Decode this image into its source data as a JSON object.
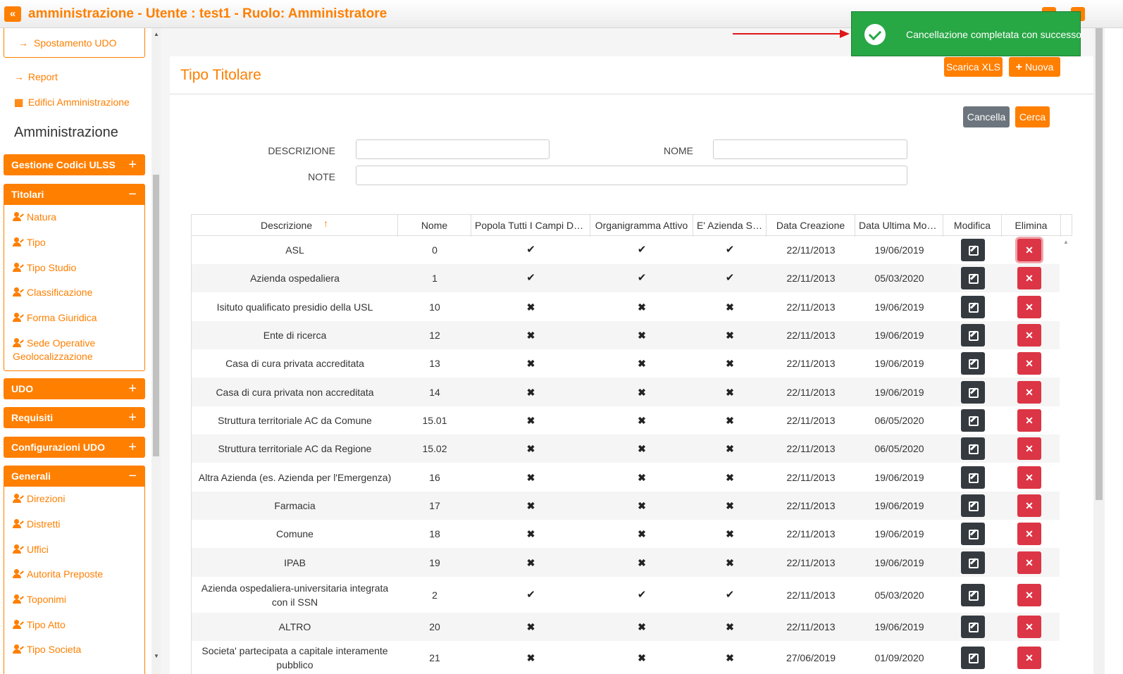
{
  "app": {
    "title": "amministrazione - Utente : test1 - Ruolo: Amministratore",
    "collapse_icon": "«"
  },
  "sidebar": {
    "top_button": "Spostamento UDO",
    "links": [
      "Report",
      "Edifici Amministrazione"
    ],
    "section_title": "Amministrazione",
    "panels": [
      {
        "title": "Gestione Codici ULSS",
        "toggle": "+",
        "items": []
      },
      {
        "title": "Titolari",
        "toggle": "−",
        "items": [
          "Natura",
          "Tipo",
          "Tipo Studio",
          "Classificazione",
          "Forma Giuridica",
          "Sede Operative Geolocalizzazione"
        ]
      },
      {
        "title": "UDO",
        "toggle": "+",
        "items": []
      },
      {
        "title": "Requisiti",
        "toggle": "+",
        "items": []
      },
      {
        "title": "Configurazioni UDO",
        "toggle": "+",
        "items": []
      },
      {
        "title": "Generali",
        "toggle": "−",
        "items": [
          "Direzioni",
          "Distretti",
          "Uffici",
          "Autorita Preposte",
          "Toponimi",
          "Tipo Atto",
          "Tipo Societa"
        ]
      }
    ]
  },
  "page": {
    "title": "Tipo Titolare",
    "buttons": {
      "xls": "Scarica XLS",
      "new": "Nuova",
      "new_icon": "+",
      "cancel": "Cancella",
      "search": "Cerca"
    }
  },
  "filters": {
    "descrizione_label": "DESCRIZIONE",
    "nome_label": "NOME",
    "note_label": "NOTE",
    "descrizione_value": "",
    "nome_value": "",
    "note_value": ""
  },
  "toast": {
    "message": "Cancellazione completata con successo",
    "color": "#28a745"
  },
  "table": {
    "sort_icon": "↑",
    "columns": [
      "Descrizione",
      "Nome",
      "Popola Tutti I Campi Del ...",
      "Organigramma Attivo",
      "E' Azienda Sa...",
      "Data Creazione",
      "Data Ultima Modi...",
      "Modifica",
      "Elimina"
    ],
    "rows": [
      {
        "descrizione": "ASL",
        "nome": "0",
        "popola": true,
        "organigramma": true,
        "azienda": true,
        "creazione": "22/11/2013",
        "modifica": "19/06/2019"
      },
      {
        "descrizione": "Azienda ospedaliera",
        "nome": "1",
        "popola": true,
        "organigramma": true,
        "azienda": true,
        "creazione": "22/11/2013",
        "modifica": "05/03/2020"
      },
      {
        "descrizione": "Isituto qualificato presidio della USL",
        "nome": "10",
        "popola": false,
        "organigramma": false,
        "azienda": false,
        "creazione": "22/11/2013",
        "modifica": "19/06/2019"
      },
      {
        "descrizione": "Ente di ricerca",
        "nome": "12",
        "popola": false,
        "organigramma": false,
        "azienda": false,
        "creazione": "22/11/2013",
        "modifica": "19/06/2019"
      },
      {
        "descrizione": "Casa di cura privata accreditata",
        "nome": "13",
        "popola": false,
        "organigramma": false,
        "azienda": false,
        "creazione": "22/11/2013",
        "modifica": "19/06/2019"
      },
      {
        "descrizione": "Casa di cura privata non accreditata",
        "nome": "14",
        "popola": false,
        "organigramma": false,
        "azienda": false,
        "creazione": "22/11/2013",
        "modifica": "19/06/2019"
      },
      {
        "descrizione": "Struttura territoriale AC da Comune",
        "nome": "15.01",
        "popola": false,
        "organigramma": false,
        "azienda": false,
        "creazione": "22/11/2013",
        "modifica": "06/05/2020"
      },
      {
        "descrizione": "Struttura territoriale AC da Regione",
        "nome": "15.02",
        "popola": false,
        "organigramma": false,
        "azienda": false,
        "creazione": "22/11/2013",
        "modifica": "06/05/2020"
      },
      {
        "descrizione": "Altra Azienda (es. Azienda per l'Emergenza)",
        "nome": "16",
        "popola": false,
        "organigramma": false,
        "azienda": false,
        "creazione": "22/11/2013",
        "modifica": "19/06/2019"
      },
      {
        "descrizione": "Farmacia",
        "nome": "17",
        "popola": false,
        "organigramma": false,
        "azienda": false,
        "creazione": "22/11/2013",
        "modifica": "19/06/2019"
      },
      {
        "descrizione": "Comune",
        "nome": "18",
        "popola": false,
        "organigramma": false,
        "azienda": false,
        "creazione": "22/11/2013",
        "modifica": "19/06/2019"
      },
      {
        "descrizione": "IPAB",
        "nome": "19",
        "popola": false,
        "organigramma": false,
        "azienda": false,
        "creazione": "22/11/2013",
        "modifica": "19/06/2019"
      },
      {
        "descrizione": "Azienda ospedaliera-universitaria integrata con il SSN",
        "nome": "2",
        "popola": true,
        "organigramma": true,
        "azienda": true,
        "creazione": "22/11/2013",
        "modifica": "05/03/2020"
      },
      {
        "descrizione": "ALTRO",
        "nome": "20",
        "popola": false,
        "organigramma": false,
        "azienda": false,
        "creazione": "22/11/2013",
        "modifica": "19/06/2019"
      },
      {
        "descrizione": "Societa' partecipata a capitale interamente pubblico",
        "nome": "21",
        "popola": false,
        "organigramma": false,
        "azienda": false,
        "creazione": "27/06/2019",
        "modifica": "01/09/2020"
      }
    ]
  },
  "icons": {
    "check": "✔",
    "cross": "✖",
    "delete": "✕"
  }
}
